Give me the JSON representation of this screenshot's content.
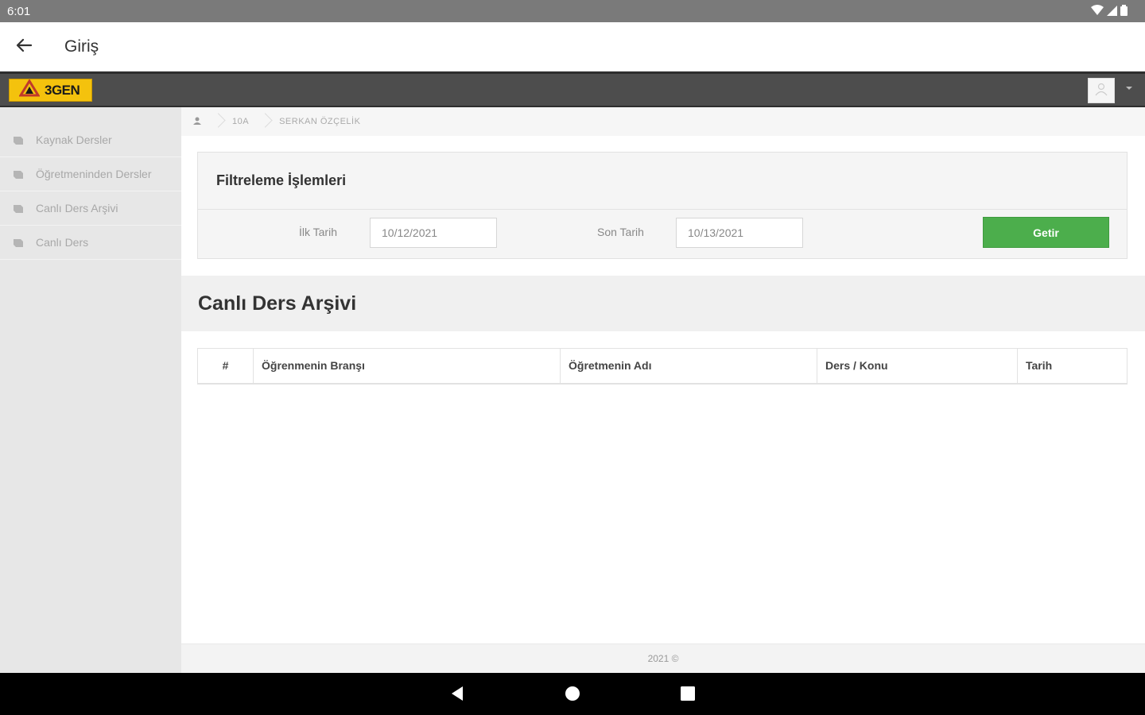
{
  "status_bar": {
    "time": "6:01"
  },
  "app_bar": {
    "title": "Giriş"
  },
  "header": {
    "logo_text": "3GEN"
  },
  "sidebar": {
    "items": [
      {
        "label": "Kaynak Dersler"
      },
      {
        "label": "Öğretmeninden Dersler"
      },
      {
        "label": "Canlı Ders Arşivi"
      },
      {
        "label": "Canlı Ders"
      }
    ]
  },
  "breadcrumb": {
    "class_name": "10A",
    "student_name": "SERKAN ÖZÇELİK"
  },
  "filter": {
    "title": "Filtreleme İşlemleri",
    "start_label": "İlk Tarih",
    "start_value": "10/12/2021",
    "end_label": "Son Tarih",
    "end_value": "10/13/2021",
    "submit_label": "Getir",
    "submit_color": "#4cae4c"
  },
  "archive": {
    "title": "Canlı Ders Arşivi",
    "columns": [
      "#",
      "Öğrenmenin Branşı",
      "Öğretmenin Adı",
      "Ders / Konu",
      "Tarih"
    ]
  },
  "footer": {
    "text": "2021 ©"
  }
}
